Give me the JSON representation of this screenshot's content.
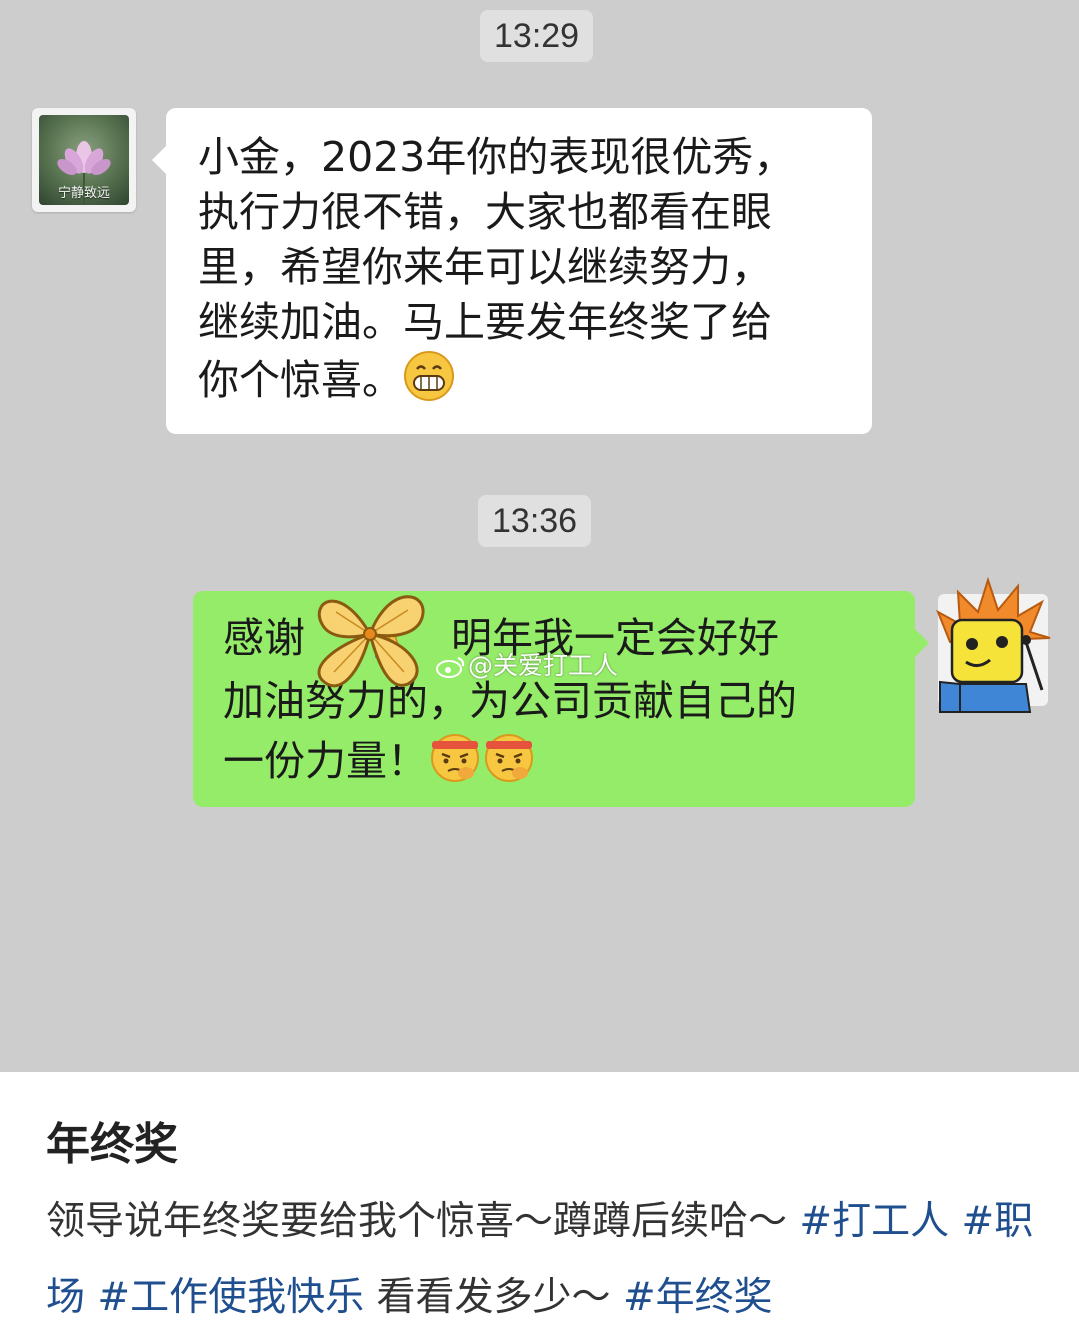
{
  "chat": {
    "time1": "13:29",
    "time2": "13:36",
    "left_avatar_caption": "宁静致远",
    "incoming": {
      "lines": [
        "小金，2023年你的表现很优秀，",
        "执行力很不错，大家也都看在眼",
        "里，希望你来年可以继续努力，",
        "继续加油。马上要发年终奖了给",
        "你个惊喜。"
      ],
      "emoji": "grin-emoji"
    },
    "outgoing": {
      "line1_a": "感谢",
      "line1_b": "明年我一定会好好",
      "line2": "加油努力的，为公司贡献自己的",
      "line3": "一份力量！",
      "emojis": [
        "pray-emoji",
        "determined-emoji",
        "determined-emoji"
      ]
    },
    "watermark": "@关爱打工人",
    "colors": {
      "background": "#cdcdcd",
      "incoming_bubble": "#ffffff",
      "outgoing_bubble": "#95ec69"
    }
  },
  "post": {
    "title": "年终奖",
    "text1": "领导说年终奖要给我个惊喜～蹲蹲后续哈～",
    "tag1": "#打工人",
    "tag2": "#职场",
    "tag3": "#工作使我快乐",
    "text2": "看看发多少～",
    "tag4": "#年终奖",
    "hashtag_color": "#1f4f8f"
  }
}
